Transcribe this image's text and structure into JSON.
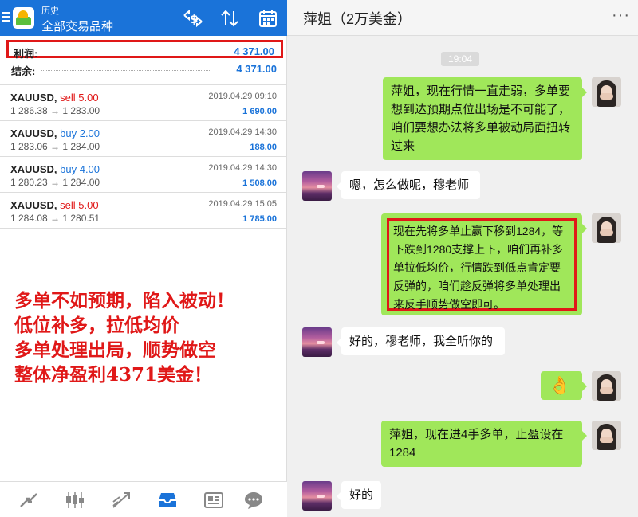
{
  "app": {
    "subtitle": "历史",
    "title": "全部交易品种",
    "icons": [
      "dollar-swap-icon",
      "sort-icon",
      "calendar-icon"
    ]
  },
  "summary": {
    "profit_label": "利润:",
    "profit_value": "4 371.00",
    "balance_label": "结余:",
    "balance_value": "4 371.00"
  },
  "trades": [
    {
      "symbol": "XAUUSD,",
      "side": "sell 5.00",
      "prices": "1 286.38 → 1 283.00",
      "datetime": "2019.04.29 09:10",
      "profit": "1 690.00"
    },
    {
      "symbol": "XAUUSD,",
      "side": "buy 2.00",
      "prices": "1 283.06 → 1 284.00",
      "datetime": "2019.04.29 14:30",
      "profit": "188.00"
    },
    {
      "symbol": "XAUUSD,",
      "side": "buy 4.00",
      "prices": "1 280.23 → 1 284.00",
      "datetime": "2019.04.29 14:30",
      "profit": "1 508.00"
    },
    {
      "symbol": "XAUUSD,",
      "side": "sell 5.00",
      "prices": "1 284.08 → 1 280.51",
      "datetime": "2019.04.29 15:05",
      "profit": "1 785.00"
    }
  ],
  "overlay": {
    "line1": "多单不如预期，陷入被动！",
    "line2": "低位补多，拉低均价",
    "line3": "多单处理出局，顺势做空",
    "line4": "整体净盈利4371美金！"
  },
  "bottom_nav": [
    "quotes-icon",
    "chart-icon",
    "trade-icon",
    "history-icon",
    "news-icon",
    "chat-icon"
  ],
  "chat": {
    "title": "萍姐（2万美金）",
    "more": "···",
    "timestamp": "19:04",
    "messages": [
      {
        "from": "me",
        "text": "萍姐，现在行情一直走弱，多单要想到达预期点位出场是不可能了，咱们要想办法将多单被动局面扭转过来"
      },
      {
        "from": "her",
        "text": "嗯，怎么做呢，穆老师"
      },
      {
        "from": "me",
        "text": "现在先将多单止赢下移到1284，等下跌到1280支撑上下，咱们再补多单拉低均价，行情跌到低点肯定要反弹的，咱们趁反弹将多单处理出来反手顺势做空即可。"
      },
      {
        "from": "her",
        "text": "好的，穆老师，我全听你的"
      },
      {
        "from": "me",
        "text": "👌"
      },
      {
        "from": "me",
        "text": "萍姐，现在进4手多单，止盈设在1284"
      },
      {
        "from": "her",
        "text": "好的"
      }
    ]
  },
  "colors": {
    "brand_blue": "#1a73d9",
    "sell_red": "#e01818",
    "bubble_green": "#a0e75a"
  }
}
